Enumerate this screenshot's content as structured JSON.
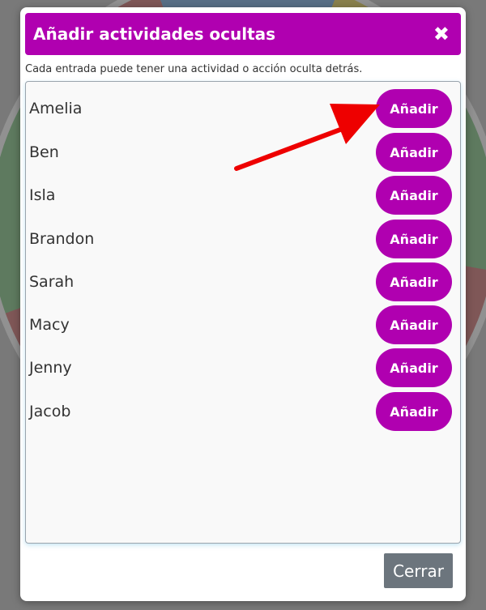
{
  "modal": {
    "title": "Añadir actividades ocultas",
    "close_icon": "close-icon",
    "subtitle": "Cada entrada puede tener una actividad o acción oculta detrás.",
    "entries": [
      {
        "name": "Amelia",
        "button": "Añadir"
      },
      {
        "name": "Ben",
        "button": "Añadir"
      },
      {
        "name": "Isla",
        "button": "Añadir"
      },
      {
        "name": "Brandon",
        "button": "Añadir"
      },
      {
        "name": "Sarah",
        "button": "Añadir"
      },
      {
        "name": "Macy",
        "button": "Añadir"
      },
      {
        "name": "Jenny",
        "button": "Añadir"
      },
      {
        "name": "Jacob",
        "button": "Añadir"
      }
    ],
    "footer_button": "Cerrar"
  },
  "colors": {
    "accent": "#b000b0",
    "secondary_button": "#6c757d",
    "annotation_arrow": "#ee0000"
  }
}
